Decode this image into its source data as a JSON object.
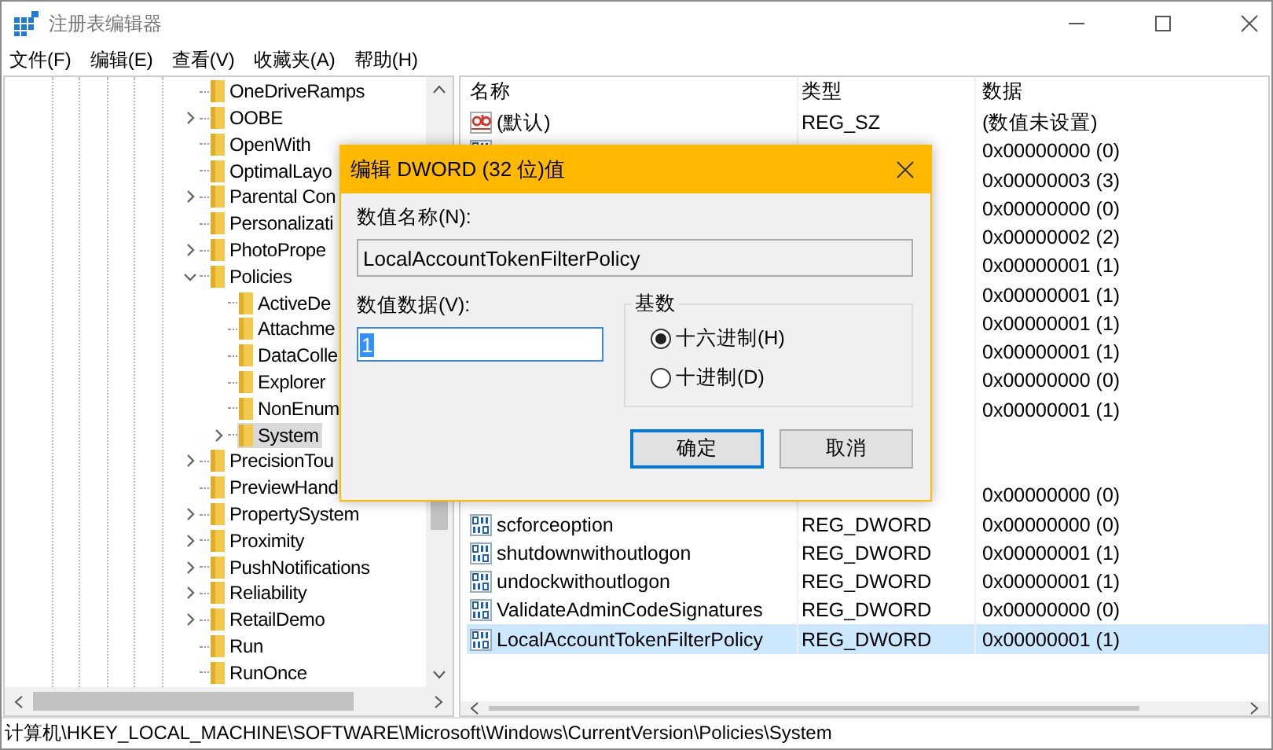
{
  "window": {
    "title": "注册表编辑器"
  },
  "menu": [
    "文件(F)",
    "编辑(E)",
    "查看(V)",
    "收藏夹(A)",
    "帮助(H)"
  ],
  "tree": {
    "items": [
      {
        "label": "OneDriveRamps",
        "selected": false
      },
      {
        "label": "OOBE",
        "expanded": false,
        "selected": false
      },
      {
        "label": "OpenWith",
        "selected": false
      },
      {
        "label": "OptimalLayo",
        "selected": false
      },
      {
        "label": "Parental Con",
        "expanded": false,
        "selected": false
      },
      {
        "label": "Personalizati",
        "selected": false
      },
      {
        "label": "PhotoPrope",
        "expanded": false,
        "selected": false
      },
      {
        "label": "Policies",
        "expanded": true,
        "selected": false,
        "children": [
          {
            "label": "ActiveDe",
            "selected": false
          },
          {
            "label": "Attachme",
            "selected": false
          },
          {
            "label": "DataColle",
            "selected": false
          },
          {
            "label": "Explorer",
            "selected": false
          },
          {
            "label": "NonEnum",
            "selected": false
          },
          {
            "label": "System",
            "expanded": false,
            "selected": true
          }
        ]
      },
      {
        "label": "PrecisionTou",
        "expanded": false,
        "selected": false
      },
      {
        "label": "PreviewHand",
        "selected": false
      },
      {
        "label": "PropertySystem",
        "expanded": false,
        "selected": false
      },
      {
        "label": "Proximity",
        "expanded": false,
        "selected": false
      },
      {
        "label": "PushNotifications",
        "expanded": false,
        "selected": false
      },
      {
        "label": "Reliability",
        "expanded": false,
        "selected": false
      },
      {
        "label": "RetailDemo",
        "expanded": false,
        "selected": false
      },
      {
        "label": "Run",
        "selected": false
      },
      {
        "label": "RunOnce",
        "selected": false
      }
    ]
  },
  "values": {
    "columns": [
      "名称",
      "类型",
      "数据"
    ],
    "rows": [
      {
        "kind": "string",
        "name": "(默认)",
        "type": "REG_SZ",
        "data": "(数值未设置)",
        "selected": false
      },
      {
        "kind": "dword",
        "data": "0x00000000 (0)",
        "selected": false
      },
      {
        "data": "0x00000003 (3)",
        "selected": false
      },
      {
        "data": "0x00000000 (0)",
        "selected": false
      },
      {
        "data": "0x00000002 (2)",
        "selected": false
      },
      {
        "data": "0x00000001 (1)",
        "selected": false
      },
      {
        "data": "0x00000001 (1)",
        "selected": false
      },
      {
        "data": "0x00000001 (1)",
        "selected": false
      },
      {
        "data": "0x00000001 (1)",
        "selected": false
      },
      {
        "data": "0x00000000 (0)",
        "selected": false
      },
      {
        "data": "0x00000001 (1)",
        "selected": false
      },
      {
        "selected": false
      },
      {
        "selected": false
      },
      {
        "data": "0x00000000 (0)",
        "selected": false
      },
      {
        "kind": "dword",
        "name": "scforceoption",
        "type": "REG_DWORD",
        "data": "0x00000000 (0)",
        "selected": false
      },
      {
        "kind": "dword",
        "name": "shutdownwithoutlogon",
        "type": "REG_DWORD",
        "data": "0x00000001 (1)",
        "selected": false
      },
      {
        "kind": "dword",
        "name": "undockwithoutlogon",
        "type": "REG_DWORD",
        "data": "0x00000001 (1)",
        "selected": false
      },
      {
        "kind": "dword",
        "name": "ValidateAdminCodeSignatures",
        "type": "REG_DWORD",
        "data": "0x00000000 (0)",
        "selected": false
      },
      {
        "kind": "dword",
        "name": "LocalAccountTokenFilterPolicy",
        "type": "REG_DWORD",
        "data": "0x00000001 (1)",
        "selected": true
      }
    ]
  },
  "status_bar": "计算机\\HKEY_LOCAL_MACHINE\\SOFTWARE\\Microsoft\\Windows\\CurrentVersion\\Policies\\System",
  "dialog": {
    "title": "编辑 DWORD (32 位)值",
    "name_label": "数值名称(N):",
    "name_value": "LocalAccountTokenFilterPolicy",
    "data_label": "数值数据(V):",
    "data_value": "1",
    "base_label": "基数",
    "bases": [
      {
        "label": "十六进制(H)",
        "selected": true
      },
      {
        "label": "十进制(D)",
        "selected": false
      }
    ],
    "buttons": [
      {
        "label": "确定",
        "default": true
      },
      {
        "label": "取消",
        "default": false
      }
    ]
  }
}
